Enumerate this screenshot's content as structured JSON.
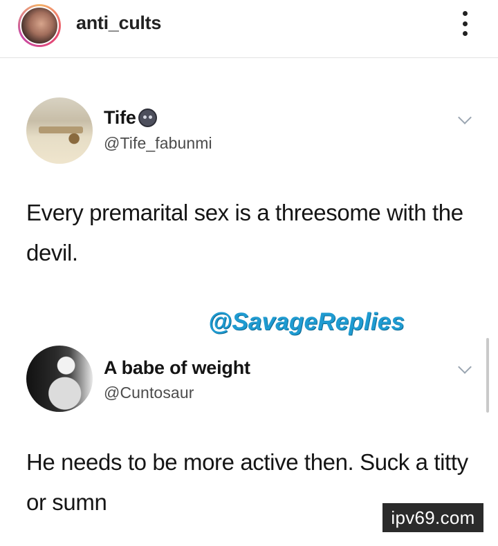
{
  "post": {
    "username": "anti_cults"
  },
  "tweets": [
    {
      "display_name": "Tife",
      "handle": "@Tife_fabunmi",
      "text": "Every premarital sex is a threesome with the devil.",
      "emoji": "dark-face-emoji"
    },
    {
      "display_name": "A babe of weight",
      "handle": "@Cuntosaur",
      "text": "He needs to be more active then. Suck a titty or sumn"
    }
  ],
  "watermark": "@SavageReplies",
  "site_badge": "ipv69.com",
  "colors": {
    "watermark": "#1f9bd1",
    "badge_bg": "#2b2b2b",
    "text": "#151515",
    "handle": "#4b4b4b"
  }
}
